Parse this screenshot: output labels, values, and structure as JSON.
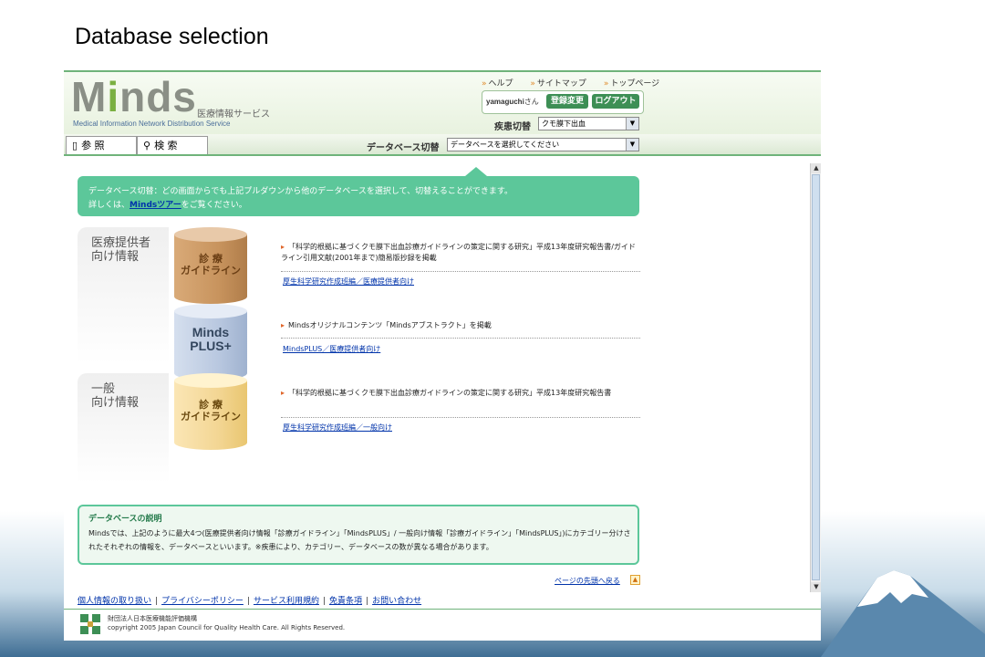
{
  "slide_title": "Database selection",
  "header": {
    "logo_text": "Minds",
    "logo_sub_jp": "医療情報サービス",
    "logo_sub_en": "Medical Information Network Distribution Service",
    "top_links": [
      "ヘルプ",
      "サイトマップ",
      "トップページ"
    ],
    "username": "yamaguchi",
    "username_suffix": "さん",
    "btn_register": "登録変更",
    "btn_logout": "ログアウト",
    "disease_label": "疾患切替",
    "disease_value": "クモ膜下出血"
  },
  "tabs": {
    "reference": "参 照",
    "search": "検 索",
    "db_switch_label": "データベース切替",
    "db_switch_value": "データベースを選択してください"
  },
  "notice": {
    "line1": "データベース切替：どの画面からでも上記プルダウンから他のデータベースを選択して、切替えることができます。",
    "line2_pre": "詳しくは、",
    "line2_link": "Mindsツアー",
    "line2_post": "をご覧ください。"
  },
  "sections": {
    "provider_label": "医療提供者\n向け情報",
    "general_label": "一般\n向け情報"
  },
  "databases": [
    {
      "cylinder_label": "診 療\nガイドライン",
      "entry": "「科学的根拠に基づくクモ膜下出血診療ガイドラインの策定に関する研究」平成13年度研究報告書/ガイドライン引用文献(2001年まで)簡易版抄録を掲載",
      "link": "厚生科学研究作成班編／医療提供者向け",
      "color_top": "#e8c9a9",
      "color_body": "#c8945e"
    },
    {
      "cylinder_label": "Minds\nPLUS+",
      "entry": "Mindsオリジナルコンテンツ「Mindsアブストラクト」を掲載",
      "link": "MindsPLUS／医療提供者向け",
      "color_top": "#e6ecf6",
      "color_body": "#b9c8e0"
    },
    {
      "cylinder_label": "診 療\nガイドライン",
      "entry": "「科学的根拠に基づくクモ膜下出血診療ガイドラインの策定に関する研究」平成13年度研究報告書",
      "link": "厚生科学研究作成班編／一般向け",
      "color_top": "#fff3cf",
      "color_body": "#f3d694"
    }
  ],
  "explain": {
    "title": "データベースの説明",
    "text": "Mindsでは、上記のように最大4つ(医療提供者向け情報「診療ガイドライン」「MindsPLUS」/ 一般向け情報「診療ガイドライン」「MindsPLUS」)にカテゴリー分けされたそれぞれの情報を、データベースといいます。※疾患により、カテゴリー、データベースの数が異なる場合があります。"
  },
  "page_top": "ページの先頭へ戻る",
  "footer": {
    "links": [
      "個人情報の取り扱い",
      "プライバシーポリシー",
      "サービス利用規約",
      "免責条項",
      "お問い合わせ"
    ],
    "org_name": "財団法人日本医療機能評価機構",
    "copyright": "copyright 2005 Japan Council for Quality Health Care. All Rights Reserved."
  },
  "colors": {
    "accent_green": "#5cc79a",
    "link_blue": "#0033aa"
  }
}
